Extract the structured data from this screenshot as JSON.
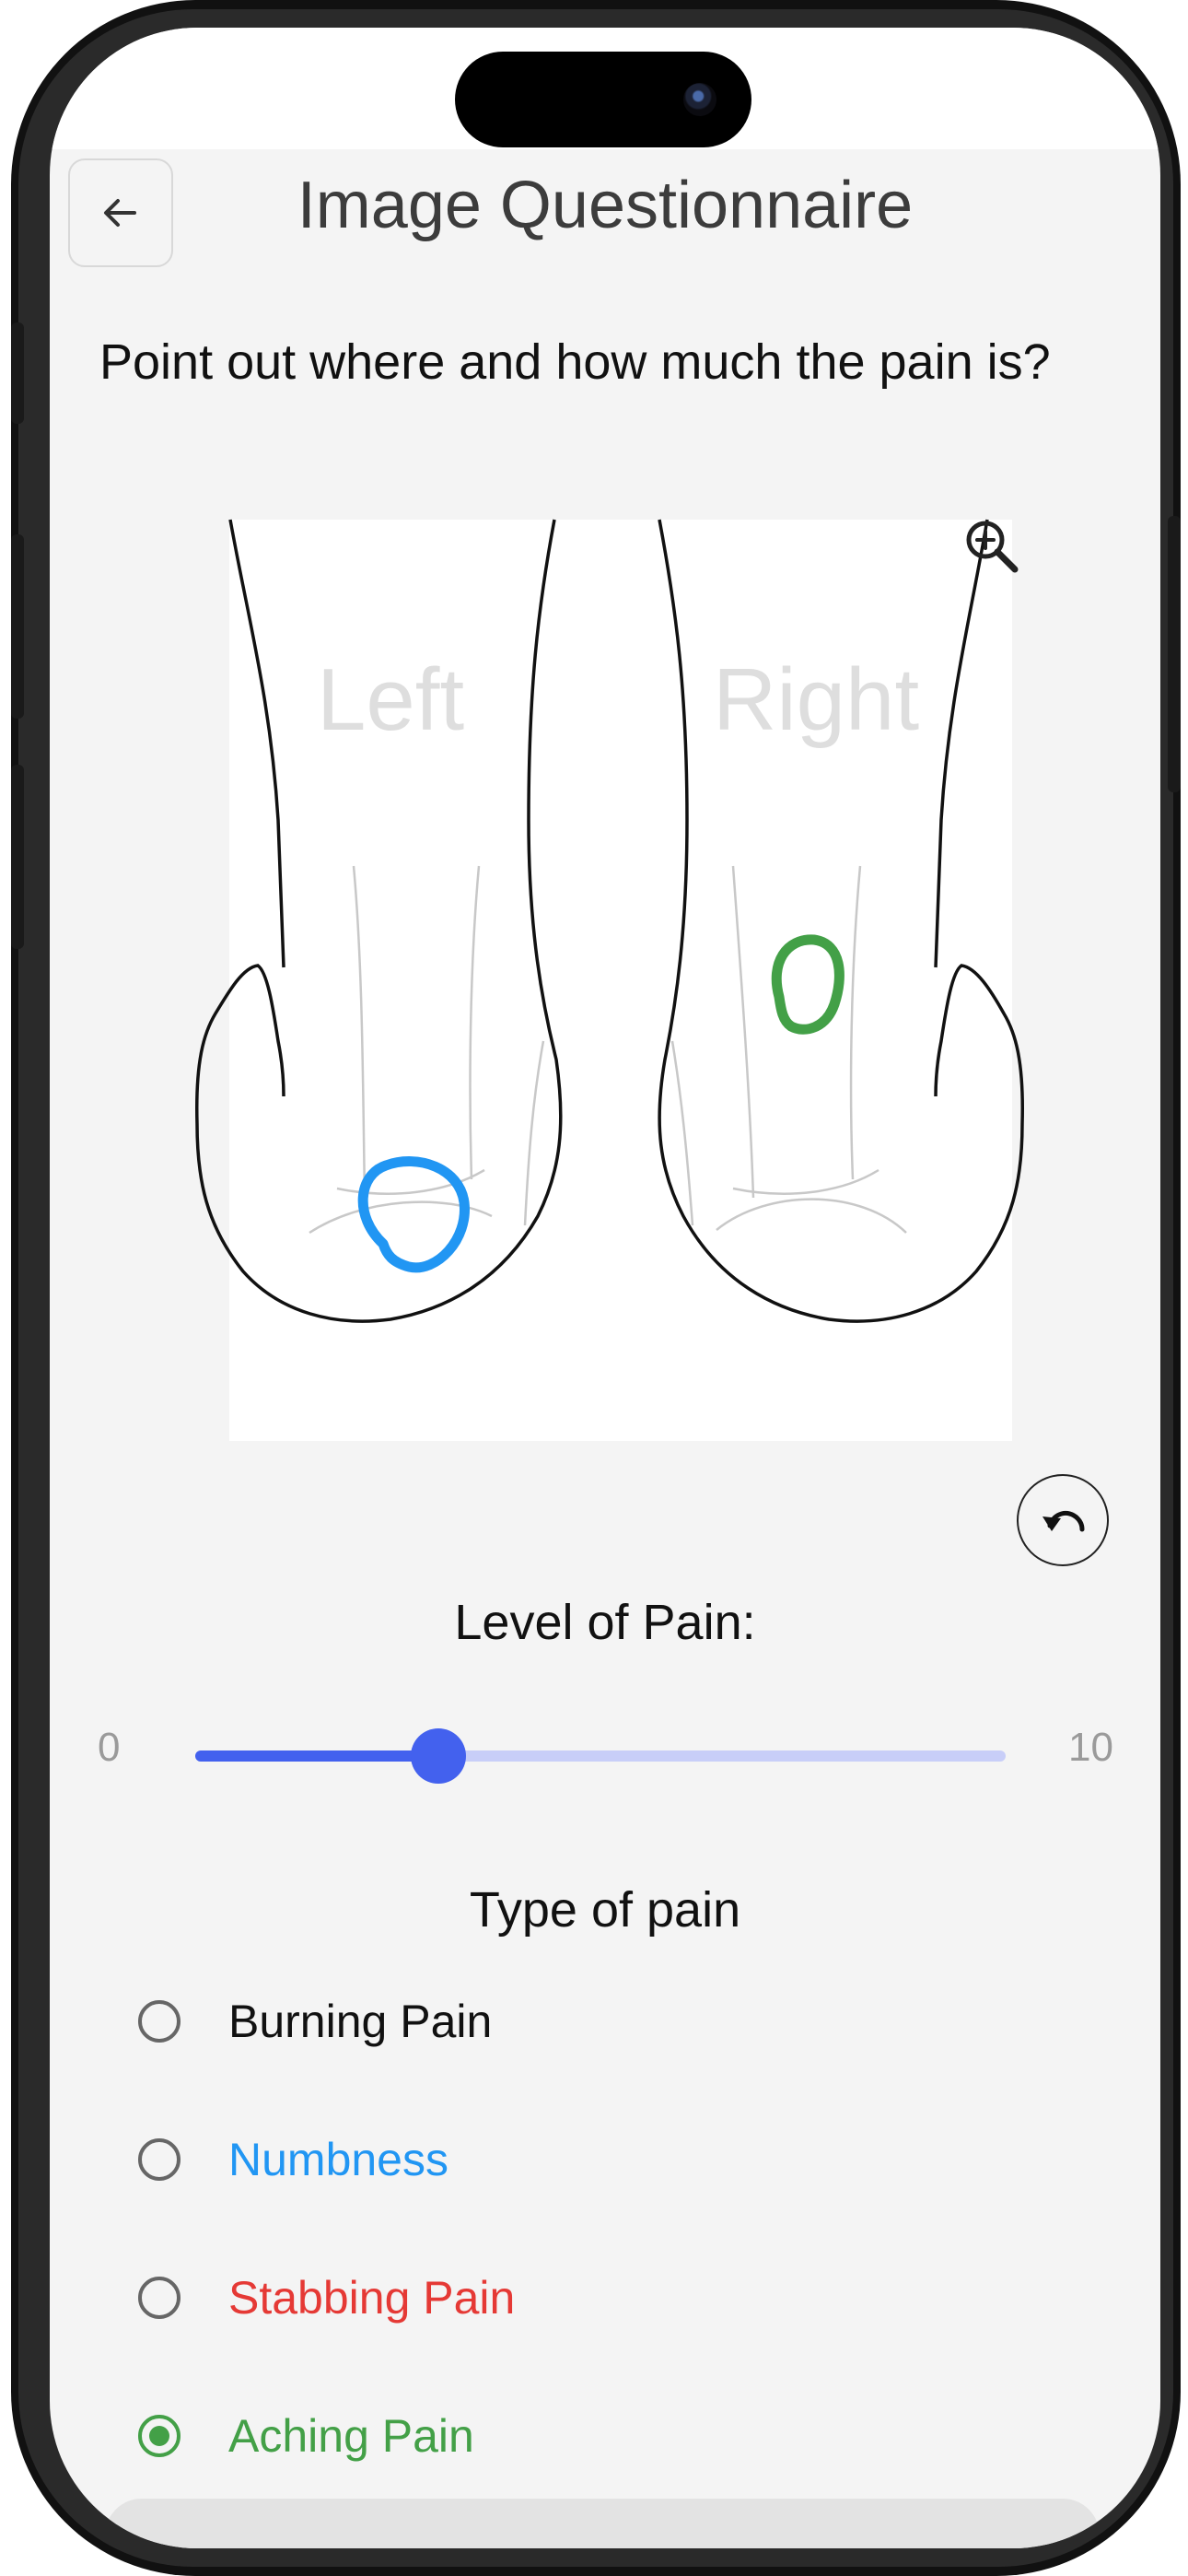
{
  "header": {
    "title": "Image Questionnaire",
    "back_icon": "arrow-left-icon"
  },
  "question": {
    "text": "Point out where and how much the pain is?"
  },
  "feet_diagram": {
    "left_label": "Left",
    "right_label": "Right",
    "zoom_icon": "zoom-in-icon",
    "markings": [
      {
        "foot": "left",
        "area": "heel",
        "color": "#2196f3"
      },
      {
        "foot": "right",
        "area": "ankle",
        "color": "#43a047"
      }
    ]
  },
  "undo": {
    "icon": "undo-icon"
  },
  "pain_level": {
    "label": "Level of Pain:",
    "min_label": "0",
    "max_label": "10",
    "min": 0,
    "max": 10,
    "value": 3,
    "accent_color": "#4361ee"
  },
  "pain_type": {
    "label": "Type of pain",
    "options": [
      {
        "label": "Burning Pain",
        "color": "#111111",
        "selected": false
      },
      {
        "label": "Numbness",
        "color": "#2196f3",
        "selected": false
      },
      {
        "label": "Stabbing Pain",
        "color": "#e53935",
        "selected": false
      },
      {
        "label": "Aching Pain",
        "color": "#43a047",
        "selected": true
      }
    ]
  }
}
